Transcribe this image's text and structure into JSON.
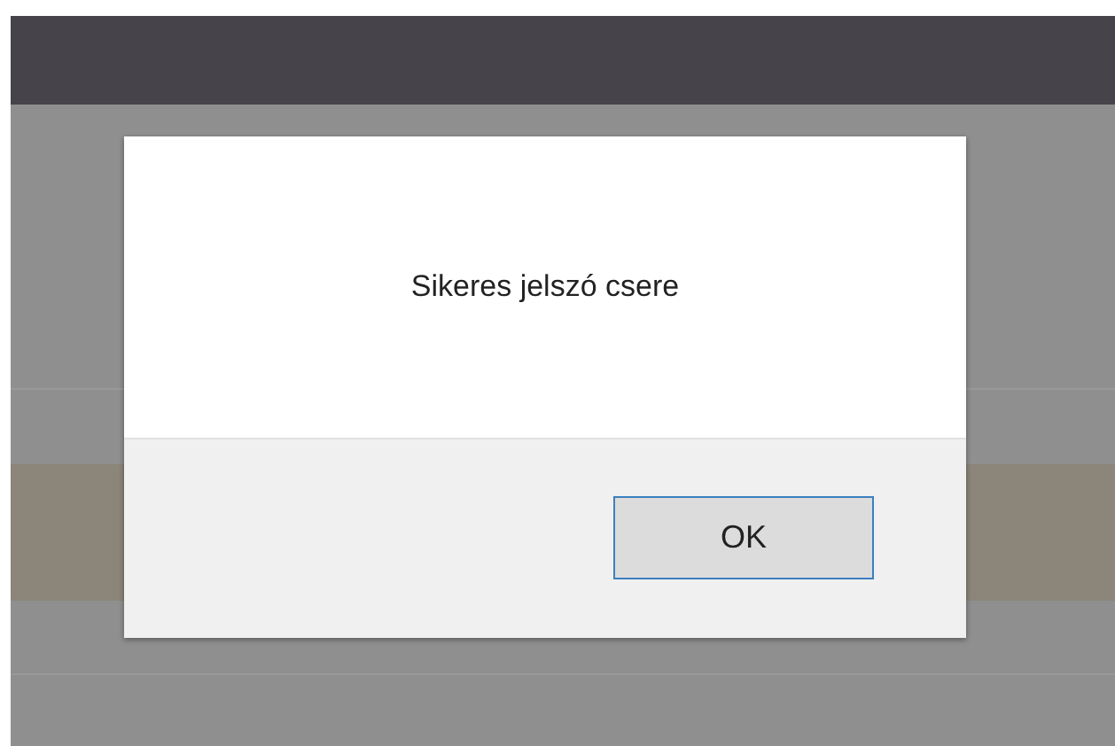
{
  "dialog": {
    "message": "Sikeres jelszó csere",
    "buttons": [
      "OK"
    ]
  }
}
